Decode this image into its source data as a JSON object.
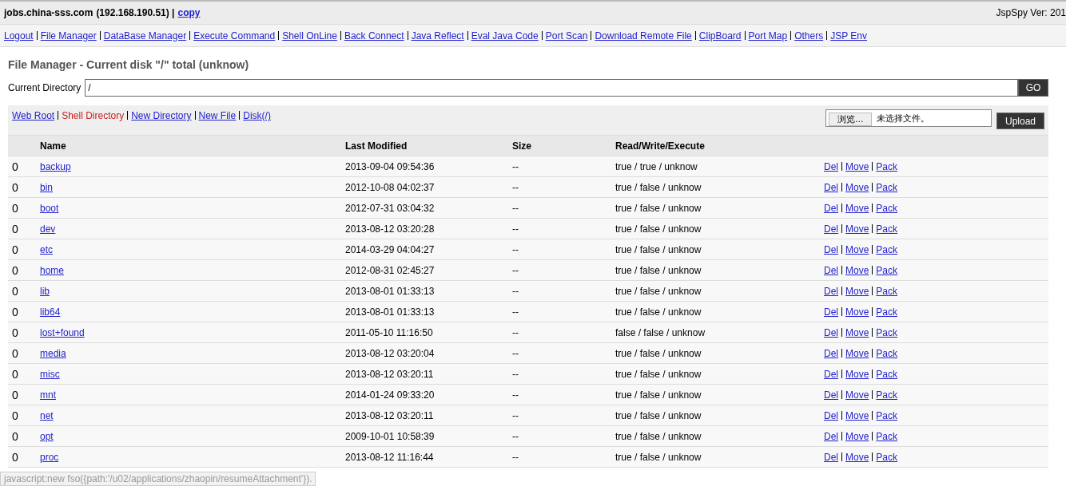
{
  "header": {
    "host": "jobs.china-sss.com",
    "ip": "(192.168.190.51) |",
    "copy_link": "copy",
    "version": "JspSpy Ver: 201"
  },
  "nav": [
    "Logout",
    "File Manager",
    "DataBase Manager",
    "Execute Command",
    "Shell OnLine",
    "Back Connect",
    "Java Reflect",
    "Eval Java Code",
    "Port Scan",
    "Download Remote File",
    "ClipBoard",
    "Port Map",
    "Others",
    "JSP Env"
  ],
  "title": "File Manager - Current disk \"/\" total (unknow)",
  "directory": {
    "label": "Current Directory",
    "value": "/",
    "button": "GO"
  },
  "toolbar": [
    {
      "label": "Web Root",
      "selected": false
    },
    {
      "label": "Shell Directory",
      "selected": true
    },
    {
      "label": "New Directory",
      "selected": false
    },
    {
      "label": "New File",
      "selected": false
    },
    {
      "label": "Disk(/)",
      "selected": false
    }
  ],
  "upload": {
    "browse": "浏览...",
    "no_file": "未选择文件。",
    "button": "Upload"
  },
  "table": {
    "columns": [
      "Name",
      "Last Modified",
      "Size",
      "Read/Write/Execute"
    ],
    "rows": [
      {
        "index": "0",
        "name": "backup",
        "modified": "2013-09-04 09:54:36",
        "size": "--",
        "rwx": "true / true / unknow",
        "actions": [
          "Del",
          "Move",
          "Pack"
        ]
      },
      {
        "index": "0",
        "name": "bin",
        "modified": "2012-10-08 04:02:37",
        "size": "--",
        "rwx": "true / false / unknow",
        "actions": [
          "Del",
          "Move",
          "Pack"
        ]
      },
      {
        "index": "0",
        "name": "boot",
        "modified": "2012-07-31 03:04:32",
        "size": "--",
        "rwx": "true / false / unknow",
        "actions": [
          "Del",
          "Move",
          "Pack"
        ]
      },
      {
        "index": "0",
        "name": "dev",
        "modified": "2013-08-12 03:20:28",
        "size": "--",
        "rwx": "true / false / unknow",
        "actions": [
          "Del",
          "Move",
          "Pack"
        ]
      },
      {
        "index": "0",
        "name": "etc",
        "modified": "2014-03-29 04:04:27",
        "size": "--",
        "rwx": "true / false / unknow",
        "actions": [
          "Del",
          "Move",
          "Pack"
        ]
      },
      {
        "index": "0",
        "name": "home",
        "modified": "2012-08-31 02:45:27",
        "size": "--",
        "rwx": "true / false / unknow",
        "actions": [
          "Del",
          "Move",
          "Pack"
        ]
      },
      {
        "index": "0",
        "name": "lib",
        "modified": "2013-08-01 01:33:13",
        "size": "--",
        "rwx": "true / false / unknow",
        "actions": [
          "Del",
          "Move",
          "Pack"
        ]
      },
      {
        "index": "0",
        "name": "lib64",
        "modified": "2013-08-01 01:33:13",
        "size": "--",
        "rwx": "true / false / unknow",
        "actions": [
          "Del",
          "Move",
          "Pack"
        ]
      },
      {
        "index": "0",
        "name": "lost+found",
        "modified": "2011-05-10 11:16:50",
        "size": "--",
        "rwx": "false / false / unknow",
        "actions": [
          "Del",
          "Move",
          "Pack"
        ]
      },
      {
        "index": "0",
        "name": "media",
        "modified": "2013-08-12 03:20:04",
        "size": "--",
        "rwx": "true / false / unknow",
        "actions": [
          "Del",
          "Move",
          "Pack"
        ]
      },
      {
        "index": "0",
        "name": "misc",
        "modified": "2013-08-12 03:20:11",
        "size": "--",
        "rwx": "true / false / unknow",
        "actions": [
          "Del",
          "Move",
          "Pack"
        ]
      },
      {
        "index": "0",
        "name": "mnt",
        "modified": "2014-01-24 09:33:20",
        "size": "--",
        "rwx": "true / false / unknow",
        "actions": [
          "Del",
          "Move",
          "Pack"
        ]
      },
      {
        "index": "0",
        "name": "net",
        "modified": "2013-08-12 03:20:11",
        "size": "--",
        "rwx": "true / false / unknow",
        "actions": [
          "Del",
          "Move",
          "Pack"
        ]
      },
      {
        "index": "0",
        "name": "opt",
        "modified": "2009-10-01 10:58:39",
        "size": "--",
        "rwx": "true / false / unknow",
        "actions": [
          "Del",
          "Move",
          "Pack"
        ]
      },
      {
        "index": "0",
        "name": "proc",
        "modified": "2013-08-12 11:16:44",
        "size": "--",
        "rwx": "true / false / unknow",
        "actions": [
          "Del",
          "Move",
          "Pack"
        ]
      }
    ]
  },
  "status_bar": "javascript:new fso({path:'/u02/applications/zhaopin/resumeAttachment'})."
}
